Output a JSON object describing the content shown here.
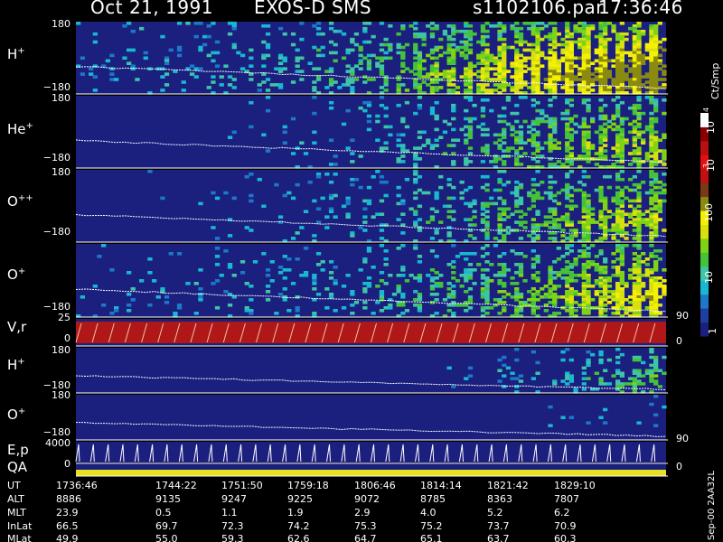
{
  "header": {
    "date": "Oct 21, 1991",
    "instrument": "EXOS-D SMS",
    "file": "s1102106.par",
    "time": "17:36:46"
  },
  "colorbar": {
    "label": "Ct/Smp",
    "tick_labels": [
      "1",
      "10",
      "100",
      "10",
      "10",
      "3",
      "4"
    ],
    "colors": [
      "#1b1f7e",
      "#1f3f9e",
      "#1d78c8",
      "#19b8d0",
      "#3fc4a6",
      "#44c23a",
      "#7ed414",
      "#d8e010",
      "#f4f000",
      "#8a8a10",
      "#7a3a18",
      "#c01010",
      "#e21010",
      "#b81010",
      "#8a0000",
      "#ffffff"
    ]
  },
  "side_labels": [
    "90",
    "0",
    "90",
    "0"
  ],
  "stamp": "Sep-00  2AA32L",
  "chart_data": {
    "type": "heatmap",
    "time_axis": {
      "label": "UT",
      "ticks": [
        "1736:46",
        "1744:22",
        "1751:50",
        "1759:18",
        "1806:46",
        "1814:14",
        "1821:42",
        "1829:10"
      ]
    },
    "panels": [
      {
        "species_base": "H",
        "species_sup": "+",
        "ylim": [
          -180,
          180
        ],
        "ytick_labels": [
          "180",
          "−180"
        ],
        "activity": [
          0.05,
          0.08,
          0.1,
          0.15,
          0.2,
          0.3,
          0.45,
          0.6,
          0.75,
          0.9,
          1.0
        ]
      },
      {
        "species_base": "He",
        "species_sup": "+",
        "ylim": [
          -180,
          180
        ],
        "ytick_labels": [
          "−180",
          "180"
        ],
        "activity": [
          0.0,
          0.0,
          0.0,
          0.02,
          0.05,
          0.1,
          0.2,
          0.3,
          0.4,
          0.5,
          0.55
        ]
      },
      {
        "species_base": "O",
        "species_sup": "++",
        "ylim": [
          -180,
          180
        ],
        "ytick_labels": [
          "−180",
          "180"
        ],
        "activity": [
          0.0,
          0.0,
          0.02,
          0.05,
          0.08,
          0.12,
          0.2,
          0.3,
          0.4,
          0.5,
          0.6
        ]
      },
      {
        "species_base": "O",
        "species_sup": "+",
        "ylim": [
          -180,
          180
        ],
        "ytick_labels": [
          "−180"
        ],
        "activity": [
          0.05,
          0.06,
          0.08,
          0.1,
          0.12,
          0.18,
          0.25,
          0.35,
          0.45,
          0.6,
          0.75
        ]
      },
      {
        "species_base": "V,r",
        "species_sup": "",
        "ylim": [
          0,
          25
        ],
        "ytick_labels": [
          "25",
          "0"
        ],
        "activity": []
      },
      {
        "species_base": "H",
        "species_sup": "+",
        "ylim": [
          -180,
          180
        ],
        "ytick_labels": [
          "180",
          "−180"
        ],
        "activity": [
          0.0,
          0.0,
          0.0,
          0.0,
          0.0,
          0.0,
          0.0,
          0.05,
          0.1,
          0.25,
          0.4
        ]
      },
      {
        "species_base": "O",
        "species_sup": "+",
        "ylim": [
          -180,
          180
        ],
        "ytick_labels": [
          "180",
          "−180"
        ],
        "activity": [
          0.0,
          0.0,
          0.0,
          0.0,
          0.0,
          0.0,
          0.0,
          0.0,
          0.02,
          0.04,
          0.06
        ]
      },
      {
        "species_base": "E,p",
        "species_sup": "",
        "ylim": [
          0,
          4000
        ],
        "ytick_labels": [
          "4000",
          "0"
        ],
        "activity": []
      },
      {
        "species_base": "QA",
        "species_sup": "",
        "ylim": [
          0,
          1
        ],
        "ytick_labels": [],
        "activity": []
      }
    ],
    "ephemeris": [
      {
        "label": "UT",
        "values": [
          "1736:46",
          "1744:22",
          "1751:50",
          "1759:18",
          "1806:46",
          "1814:14",
          "1821:42",
          "1829:10"
        ]
      },
      {
        "label": "ALT",
        "values": [
          "8886",
          "9135",
          "9247",
          "9225",
          "9072",
          "8785",
          "8363",
          "7807"
        ]
      },
      {
        "label": "MLT",
        "values": [
          "23.9",
          "0.5",
          "1.1",
          "1.9",
          "2.9",
          "4.0",
          "5.2",
          "6.2"
        ]
      },
      {
        "label": "InLat",
        "values": [
          "66.5",
          "69.7",
          "72.3",
          "74.2",
          "75.3",
          "75.2",
          "73.7",
          "70.9"
        ]
      },
      {
        "label": "MLat",
        "values": [
          "49.9",
          "55.0",
          "59.3",
          "62.6",
          "64.7",
          "65.1",
          "63.7",
          "60.3"
        ]
      }
    ]
  }
}
